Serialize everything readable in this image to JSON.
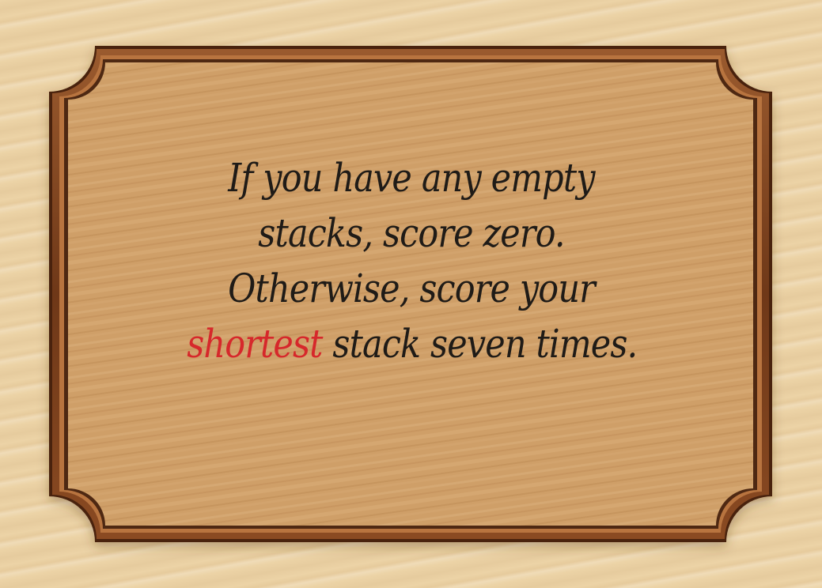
{
  "card": {
    "lines": [
      {
        "text": "If you have any empty"
      },
      {
        "text": "stacks, score zero."
      },
      {
        "text": "Otherwise, score your"
      },
      {
        "highlight": "shortest",
        "rest": " stack seven times."
      }
    ]
  },
  "colors": {
    "table_wood": "#ecd3a6",
    "card_wood": "#cf9f68",
    "frame_dark": "#4a2410",
    "frame_mid": "#8a4a22",
    "text": "#1f1b17",
    "highlight": "#d6282b"
  }
}
